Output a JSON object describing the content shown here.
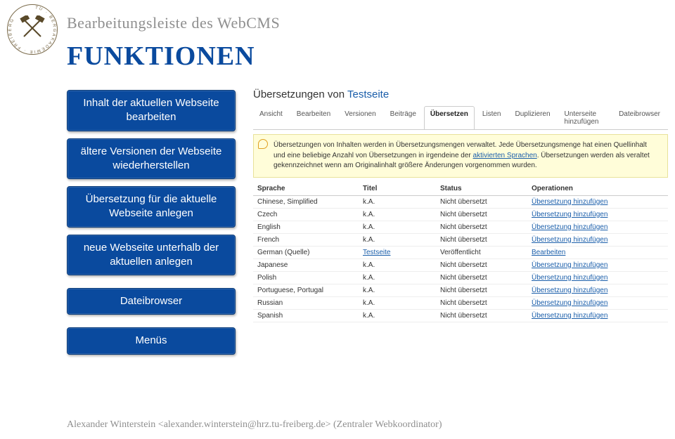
{
  "slide": {
    "subtitle": "Bearbeitungsleiste des WebCMS",
    "title": "FUNKTIONEN"
  },
  "funcs": {
    "inhalt": "Inhalt der aktuellen Webseite bearbeiten",
    "versionen": "ältere Versionen der Webseite wiederherstellen",
    "uebersetzung": "Übersetzung für die aktuelle Webseite anlegen",
    "neue": "neue Webseite unterhalb der aktuellen anlegen",
    "dateibrowser": "Dateibrowser",
    "menus": "Menüs"
  },
  "right": {
    "heading_prefix": "Übersetzungen von ",
    "heading_link": "Testseite",
    "tabs": [
      {
        "label": "Ansicht",
        "active": false
      },
      {
        "label": "Bearbeiten",
        "active": false
      },
      {
        "label": "Versionen",
        "active": false
      },
      {
        "label": "Beiträge",
        "active": false
      },
      {
        "label": "Übersetzen",
        "active": true
      },
      {
        "label": "Listen",
        "active": false
      },
      {
        "label": "Duplizieren",
        "active": false
      },
      {
        "label": "Unterseite hinzufügen",
        "active": false
      },
      {
        "label": "Dateibrowser",
        "active": false
      }
    ],
    "info": {
      "text1": "Übersetzungen von Inhalten werden in Übersetzungsmengen verwaltet. Jede Übersetzungsmenge hat einen Quellinhalt und eine beliebige Anzahl von Übersetzungen in irgendeine der ",
      "link": "aktivierten Sprachen",
      "text2": ". Übersetzungen werden als veraltet gekennzeichnet wenn am Originalinhalt größere Änderungen vorgenommen wurden."
    },
    "cols": {
      "lang": "Sprache",
      "title": "Titel",
      "status": "Status",
      "ops": "Operationen"
    },
    "rows": [
      {
        "lang": "Chinese, Simplified",
        "title": "k.A.",
        "title_link": false,
        "status": "Nicht übersetzt",
        "op": "Übersetzung hinzufügen"
      },
      {
        "lang": "Czech",
        "title": "k.A.",
        "title_link": false,
        "status": "Nicht übersetzt",
        "op": "Übersetzung hinzufügen"
      },
      {
        "lang": "English",
        "title": "k.A.",
        "title_link": false,
        "status": "Nicht übersetzt",
        "op": "Übersetzung hinzufügen"
      },
      {
        "lang": "French",
        "title": "k.A.",
        "title_link": false,
        "status": "Nicht übersetzt",
        "op": "Übersetzung hinzufügen"
      },
      {
        "lang": "German (Quelle)",
        "title": "Testseite",
        "title_link": true,
        "status": "Veröffentlicht",
        "op": "Bearbeiten"
      },
      {
        "lang": "Japanese",
        "title": "k.A.",
        "title_link": false,
        "status": "Nicht übersetzt",
        "op": "Übersetzung hinzufügen"
      },
      {
        "lang": "Polish",
        "title": "k.A.",
        "title_link": false,
        "status": "Nicht übersetzt",
        "op": "Übersetzung hinzufügen"
      },
      {
        "lang": "Portuguese, Portugal",
        "title": "k.A.",
        "title_link": false,
        "status": "Nicht übersetzt",
        "op": "Übersetzung hinzufügen"
      },
      {
        "lang": "Russian",
        "title": "k.A.",
        "title_link": false,
        "status": "Nicht übersetzt",
        "op": "Übersetzung hinzufügen"
      },
      {
        "lang": "Spanish",
        "title": "k.A.",
        "title_link": false,
        "status": "Nicht übersetzt",
        "op": "Übersetzung hinzufügen"
      }
    ]
  },
  "footer": {
    "text": "Alexander Winterstein <alexander.winterstein@hrz.tu-freiberg.de> (Zentraler Webkoordinator)"
  }
}
